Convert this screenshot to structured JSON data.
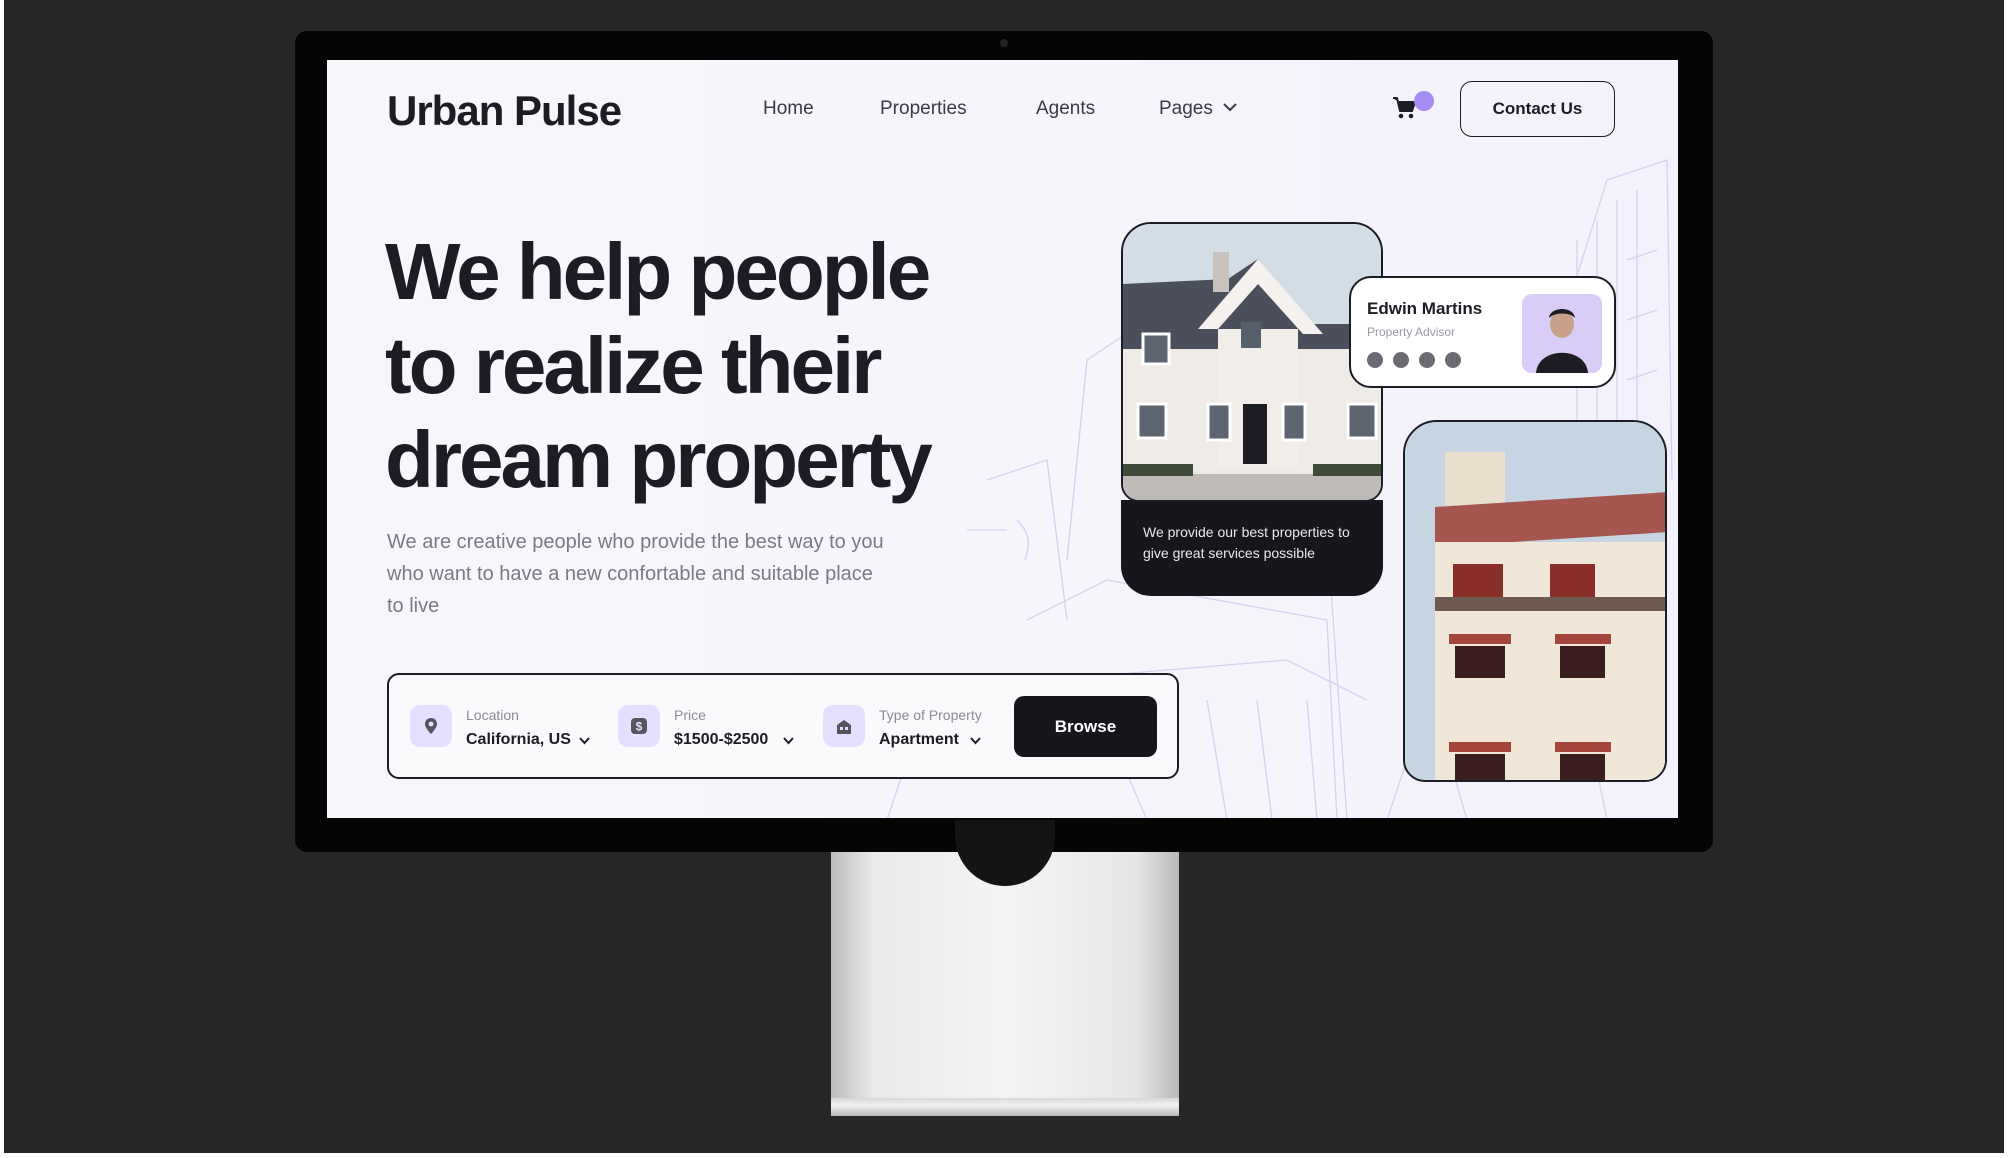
{
  "header": {
    "logo": "Urban Pulse",
    "nav": [
      "Home",
      "Properties",
      "Agents",
      "Pages"
    ],
    "contact_label": "Contact Us"
  },
  "hero": {
    "title_lines": [
      "We help people",
      "to realize their",
      "dream property"
    ],
    "subtitle": "We are creative people who provide the best way to you who want to have a new confortable and suitable place to live"
  },
  "search": {
    "fields": [
      {
        "label": "Location",
        "value": "California, US",
        "icon": "location-pin-icon"
      },
      {
        "label": "Price",
        "value": "$1500-$2500",
        "icon": "dollar-icon"
      },
      {
        "label": "Type of Property",
        "value": "Apartment",
        "icon": "building-icon"
      }
    ],
    "browse_label": "Browse"
  },
  "promo": {
    "text": "We provide our best properties to give great services possible"
  },
  "agent": {
    "name": "Edwin Martins",
    "role": "Property Advisor",
    "social_icons": [
      "phone-icon",
      "instagram-icon",
      "facebook-icon",
      "twitter-icon"
    ]
  },
  "colors": {
    "accent": "#a58cf3",
    "accent_soft": "#e6dfff",
    "ink": "#1c1c24",
    "backdrop": "#262626"
  }
}
